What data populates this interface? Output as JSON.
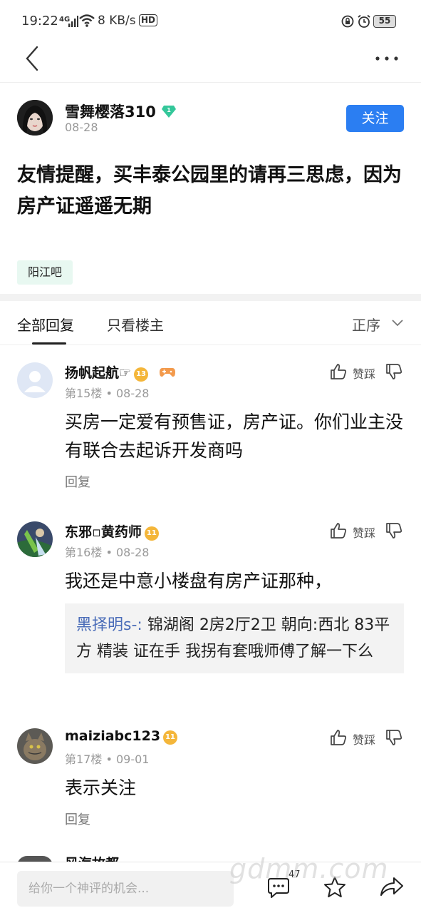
{
  "status_bar": {
    "time": "19:22",
    "network": "4G",
    "speed": "8 KB/s",
    "hd": "HD",
    "battery": "55"
  },
  "icons": {
    "back": "chevron-left-icon",
    "more": "more-dots-icon",
    "like": "thumbs-up-icon",
    "dislike": "thumbs-down-icon",
    "comment": "comment-icon",
    "favorite": "star-icon",
    "share": "share-icon"
  },
  "post": {
    "author": "雪舞樱落310",
    "date": "08-28",
    "follow_label": "关注",
    "title": "友情提醒，买丰泰公园里的请再三思虑，因为房产证遥遥无期",
    "forum": "阳江吧"
  },
  "tabs": {
    "all": "全部回复",
    "op_only": "只看楼主",
    "sort": "正序"
  },
  "replies": [
    {
      "name": "扬帆起航☞",
      "level": "13",
      "meta": "第15楼 • 08-28",
      "like_label": "赞踩",
      "content": "买房一定爱有预售证，房产证。你们业主没有联合去起诉开发商吗",
      "reply_label": "回复"
    },
    {
      "name": "东邪▫黄药师",
      "level": "11",
      "meta": "第16楼 • 08-28",
      "like_label": "赞踩",
      "content": "我还是中意小楼盘有房产证那种，",
      "quote_user": "黑择明s-:",
      "quote_text": " 锦湖阁 2房2厅2卫 朝向:西北 83平方 精装 证在手 我拐有套哦师傅了解一下么"
    },
    {
      "name": "maiziabc123",
      "level": "11",
      "meta": "第17楼 • 09-01",
      "like_label": "赞踩",
      "content": "表示关注",
      "reply_label": "回复"
    }
  ],
  "peek_name": "风海故都",
  "bottom_bar": {
    "input_placeholder": "给你一个神评的机会...",
    "comment_count": "47"
  },
  "watermark": "gdmm.com",
  "colors": {
    "accent": "#2b7ef2",
    "tag_bg": "#e8f8f1",
    "level_badge": "#f4b63a",
    "quote_user": "#4a6cb8"
  }
}
